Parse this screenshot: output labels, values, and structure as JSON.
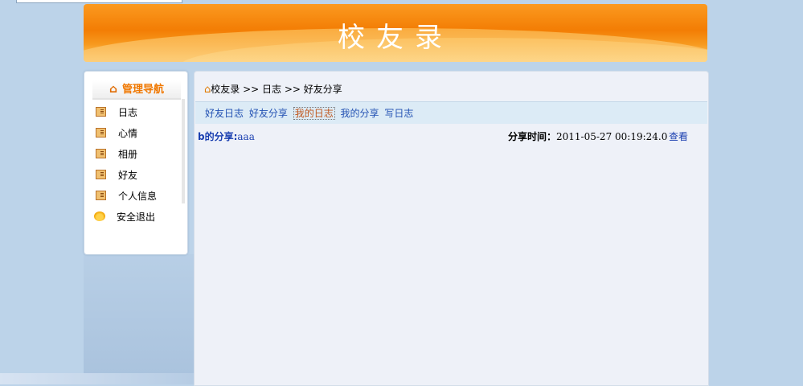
{
  "banner": {
    "title": "校友录"
  },
  "sidebar": {
    "header": "管理导航",
    "items": [
      {
        "label": "日志"
      },
      {
        "label": "心情"
      },
      {
        "label": "相册"
      },
      {
        "label": "好友"
      },
      {
        "label": "个人信息"
      },
      {
        "label": "安全退出"
      }
    ]
  },
  "breadcrumb": {
    "text": "校友录 >> 日志 >> 好友分享"
  },
  "tabs": [
    {
      "label": "好友日志"
    },
    {
      "label": "好友分享"
    },
    {
      "label": "我的日志"
    },
    {
      "label": "我的分享"
    },
    {
      "label": "写日志"
    }
  ],
  "share": {
    "owner_label": "b的分享:",
    "title": "aaa",
    "time_label": "分享时间：",
    "time": "2011-05-27 00:19:24.0",
    "view_label": "查看"
  },
  "colors": {
    "banner": "#f37d04",
    "link": "#1a3fb0",
    "accent": "#f07800"
  },
  "icons": [
    "home-icon",
    "card-icon",
    "exit-icon"
  ]
}
